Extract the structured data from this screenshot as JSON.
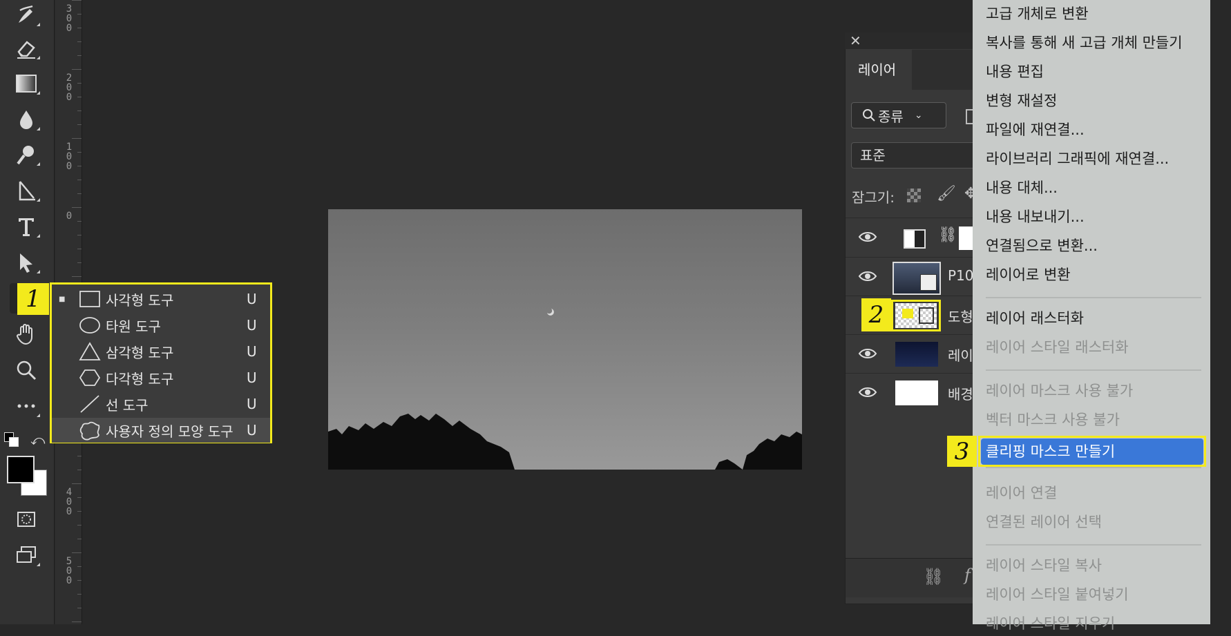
{
  "toolbar": {
    "tools": [
      "brush-tool",
      "eraser-tool",
      "gradient-tool",
      "blur-tool",
      "dodge-tool",
      "path-selection-tool",
      "type-tool",
      "direct-selection-tool",
      "shape-tool",
      "hand-tool",
      "zoom-tool",
      "more-tools"
    ]
  },
  "ruler": {
    "labels": [
      [
        "3",
        "0",
        "0"
      ],
      [
        "2",
        "0",
        "0"
      ],
      [
        "1",
        "0",
        "0"
      ],
      [
        "0"
      ],
      [
        "0"
      ],
      [
        "4",
        "0",
        "0"
      ],
      [
        "5",
        "0",
        "0"
      ]
    ]
  },
  "flyout": {
    "badge": "1",
    "items": [
      {
        "label": "사각형 도구",
        "key": "U",
        "icon": "rectangle-icon",
        "selected": true
      },
      {
        "label": "타원 도구",
        "key": "U",
        "icon": "ellipse-icon",
        "selected": false
      },
      {
        "label": "삼각형 도구",
        "key": "U",
        "icon": "triangle-icon",
        "selected": false
      },
      {
        "label": "다각형 도구",
        "key": "U",
        "icon": "polygon-icon",
        "selected": false
      },
      {
        "label": "선 도구",
        "key": "U",
        "icon": "line-icon",
        "selected": false
      },
      {
        "label": "사용자 정의 모양 도구",
        "key": "U",
        "icon": "custom-shape-icon",
        "selected": false
      }
    ]
  },
  "layers_panel": {
    "tab_label": "레이어",
    "filter_label": "종류",
    "blend_mode": "표준",
    "lock_label": "잠그기:",
    "badge": "2",
    "layers": [
      {
        "name": "",
        "thumb": "adjustment"
      },
      {
        "name": "P10",
        "thumb": "smart-object"
      },
      {
        "name": "도형",
        "thumb": "shape"
      },
      {
        "name": "레이",
        "thumb": "night-sky"
      },
      {
        "name": "배경",
        "thumb": "white"
      }
    ]
  },
  "context_menu": {
    "badge": "3",
    "items": [
      {
        "label": "고급 개체로 변환",
        "disabled": false
      },
      {
        "label": "복사를 통해 새 고급 개체 만들기",
        "disabled": false
      },
      {
        "label": "내용 편집",
        "disabled": false
      },
      {
        "label": "변형 재설정",
        "disabled": false
      },
      {
        "label": "파일에 재연결...",
        "disabled": false
      },
      {
        "label": "라이브러리 그래픽에 재연결...",
        "disabled": false
      },
      {
        "label": "내용 대체...",
        "disabled": false
      },
      {
        "label": "내용 내보내기...",
        "disabled": false
      },
      {
        "label": "연결됨으로 변환...",
        "disabled": false
      },
      {
        "label": "레이어로 변환",
        "disabled": false
      },
      {
        "label": "레이어 래스터화",
        "disabled": false
      },
      {
        "label": "레이어 스타일 래스터화",
        "disabled": true
      },
      {
        "label": "레이어 마스크 사용 불가",
        "disabled": true
      },
      {
        "label": "벡터 마스크 사용 불가",
        "disabled": true
      },
      {
        "label": "클리핑 마스크 만들기",
        "disabled": false,
        "highlighted": true
      },
      {
        "label": "레이어 연결",
        "disabled": true
      },
      {
        "label": "연결된 레이어 선택",
        "disabled": true
      },
      {
        "label": "레이어 스타일 복사",
        "disabled": true
      },
      {
        "label": "레이어 스타일 붙여넣기",
        "disabled": true
      },
      {
        "label": "레이어 스타일 지우기",
        "disabled": true
      }
    ]
  },
  "colors": {
    "highlight_border": "#f3ea1c",
    "menu_highlight": "#3a78d8",
    "menu_bg": "#c8cbc9"
  }
}
